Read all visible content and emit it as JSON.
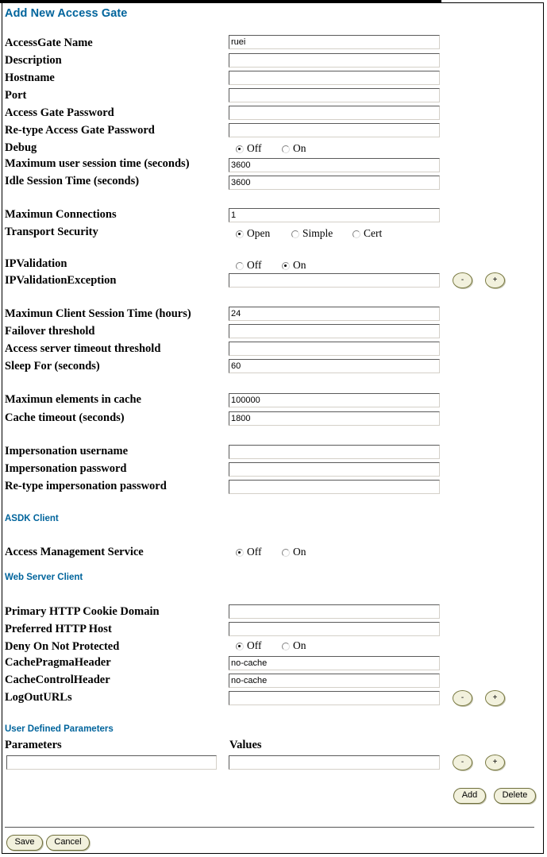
{
  "page": {
    "title": "Add New Access Gate"
  },
  "fields": [
    {
      "label": "AccessGate Name",
      "value": "ruei"
    },
    {
      "label": "Description",
      "value": ""
    },
    {
      "label": "Hostname",
      "value": ""
    },
    {
      "label": "Port",
      "value": ""
    },
    {
      "label": "Access Gate Password",
      "value": ""
    },
    {
      "label": "Re-type Access Gate Password",
      "value": ""
    },
    {
      "label": "Debug",
      "value": ""
    },
    {
      "label": "Maximum user session time (seconds)",
      "value": "3600"
    },
    {
      "label": "Idle Session Time (seconds)",
      "value": "3600"
    },
    {
      "label": "Maximun Connections",
      "value": "1"
    },
    {
      "label": "Transport Security",
      "value": ""
    },
    {
      "label": "IPValidation",
      "value": ""
    },
    {
      "label": "IPValidationException",
      "value": ""
    },
    {
      "label": "Maximun Client Session Time (hours)",
      "value": "24"
    },
    {
      "label": "Failover threshold",
      "value": ""
    },
    {
      "label": "Access server timeout threshold",
      "value": ""
    },
    {
      "label": "Sleep For (seconds)",
      "value": "60"
    },
    {
      "label": "Maximun elements in cache",
      "value": "100000"
    },
    {
      "label": "Cache timeout (seconds)",
      "value": "1800"
    },
    {
      "label": "Impersonation username",
      "value": ""
    },
    {
      "label": "Impersonation password",
      "value": ""
    },
    {
      "label": "Re-type impersonation password",
      "value": ""
    },
    {
      "label": "Access Management Service",
      "value": ""
    },
    {
      "label": "Primary HTTP Cookie Domain",
      "value": ""
    },
    {
      "label": "Preferred HTTP Host",
      "value": ""
    },
    {
      "label": "Deny On Not Protected",
      "value": ""
    },
    {
      "label": "CachePragmaHeader",
      "value": "no-cache"
    },
    {
      "label": "CacheControlHeader",
      "value": "no-cache"
    },
    {
      "label": "LogOutURLs",
      "value": ""
    },
    {
      "label": "Parameters",
      "value": ""
    },
    {
      "label": "Values",
      "value": ""
    }
  ],
  "sections": {
    "asdk_client": "ASDK Client",
    "web_server_client": "Web Server Client",
    "user_defined_parameters": "User Defined Parameters"
  },
  "radios": {
    "debug": {
      "options": [
        "Off",
        "On"
      ],
      "selected": "Off"
    },
    "transport": {
      "options": [
        "Open",
        "Simple",
        "Cert"
      ],
      "selected": "Open"
    },
    "ipvalidation": {
      "options": [
        "Off",
        "On"
      ],
      "selected": "On"
    },
    "access_mgmt": {
      "options": [
        "Off",
        "On"
      ],
      "selected": "Off"
    },
    "deny_unprotected": {
      "options": [
        "Off",
        "On"
      ],
      "selected": "Off"
    }
  },
  "buttons": {
    "minus": "-",
    "plus": "+",
    "add": "Add",
    "delete": "Delete",
    "save": "Save",
    "cancel": "Cancel"
  },
  "colors": {
    "heading": "#00649c",
    "button_face": "#f2f1dd",
    "button_border": "#6e6e3c"
  }
}
